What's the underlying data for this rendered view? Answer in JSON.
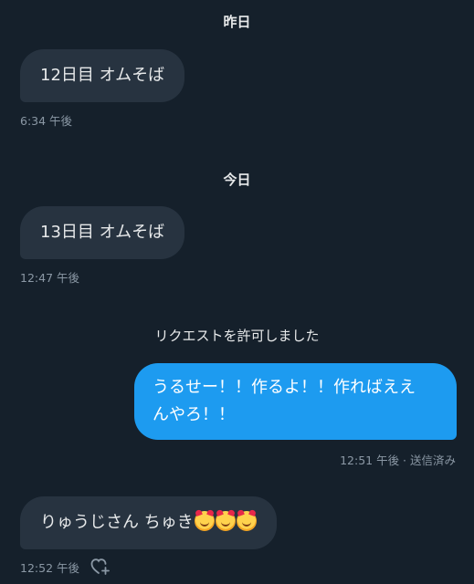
{
  "date_separators": {
    "yesterday": "昨日",
    "today": "今日"
  },
  "messages": [
    {
      "direction": "in",
      "text": "12日目 オムそば",
      "time": "6:34 午後"
    },
    {
      "direction": "in",
      "text": "13日目 オムそば",
      "time": "12:47 午後"
    },
    {
      "direction": "out",
      "line1": "うるせー！！作るよ！！作ればええ",
      "line2": "んやろ！！",
      "time": "12:51 午後 · 送信済み"
    },
    {
      "direction": "in",
      "text": "りゅうじさん ちゅき",
      "emoji": [
        "smiling-face-with-hearts",
        "smiling-face-with-hearts",
        "smiling-face-with-hearts"
      ],
      "time": "12:52 午後"
    }
  ],
  "notice": "リクエストを許可しました",
  "icons": {
    "reaction": "heart-plus-icon"
  },
  "colors": {
    "background": "#15202b",
    "incoming_bubble": "#273340",
    "outgoing_bubble": "#1d9bf0",
    "meta_text": "#8b98a5"
  }
}
